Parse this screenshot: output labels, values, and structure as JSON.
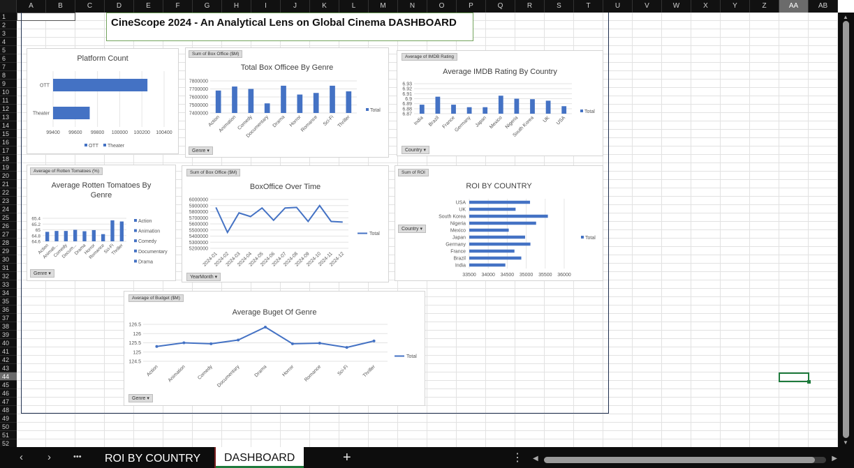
{
  "sheet": {
    "columns": [
      "A",
      "B",
      "C",
      "D",
      "E",
      "F",
      "G",
      "H",
      "I",
      "J",
      "K",
      "L",
      "M",
      "N",
      "O",
      "P",
      "Q",
      "R",
      "S",
      "T",
      "U",
      "V",
      "W",
      "X",
      "Y",
      "Z",
      "AA",
      "AB"
    ],
    "selected_column": "AA",
    "rows": [
      "1",
      "2",
      "3",
      "4",
      "5",
      "6",
      "7",
      "8",
      "9",
      "10",
      "11",
      "12",
      "13",
      "14",
      "15",
      "16",
      "17",
      "18",
      "19",
      "20",
      "21",
      "22",
      "23",
      "24",
      "25",
      "26",
      "27",
      "28",
      "29",
      "30",
      "31",
      "32",
      "33",
      "34",
      "35",
      "36",
      "37",
      "38",
      "39",
      "40",
      "41",
      "42",
      "43",
      "44",
      "45",
      "46",
      "47",
      "48",
      "49",
      "50",
      "51",
      "52"
    ],
    "selected_row": "44"
  },
  "dashboard_title": "CineScope 2024 - An Analytical Lens on Global Cinema  DASHBOARD",
  "colors": {
    "bar": "#4472c4",
    "line": "#4472c4",
    "accent": "#1e7a3c"
  },
  "charts": {
    "platform": {
      "title": "Platform Count",
      "legend": [
        "OTT",
        "Theater"
      ],
      "chart_data": {
        "type": "bar",
        "orientation": "horizontal",
        "categories": [
          "OTT",
          "Theater"
        ],
        "values": [
          100250,
          99730
        ],
        "xlim": [
          99400,
          100400
        ],
        "xticks": [
          "99400",
          "99600",
          "99800",
          "100000",
          "100200",
          "100400"
        ]
      }
    },
    "genre_box": {
      "title": "Total Box Officee By Genre",
      "field": "Sum of Box Office ($M)",
      "filter": "Genre",
      "legend": "Total",
      "chart_data": {
        "type": "bar",
        "categories": [
          "Action",
          "Animation",
          "Comedy",
          "Documentary",
          "Drama",
          "Horror",
          "Romance",
          "Sci-Fi",
          "Thriller"
        ],
        "values": [
          7680000,
          7730000,
          7700000,
          7520000,
          7740000,
          7630000,
          7650000,
          7740000,
          7670000
        ],
        "ylim": [
          7400000,
          7800000
        ],
        "yticks": [
          "7400000",
          "7500000",
          "7600000",
          "7700000",
          "7800000"
        ]
      }
    },
    "imdb": {
      "title": "Average IMDB Rating By Country",
      "field": "Average of IMDB Rating",
      "filter": "Country",
      "legend": "Total",
      "chart_data": {
        "type": "bar",
        "categories": [
          "India",
          "Brazil",
          "France",
          "Germany",
          "Japan",
          "Mexico",
          "Nigeria",
          "South Korea",
          "UK",
          "USA"
        ],
        "values": [
          6.888,
          6.904,
          6.888,
          6.883,
          6.883,
          6.906,
          6.9,
          6.899,
          6.896,
          6.885
        ],
        "ylim": [
          6.87,
          6.93
        ],
        "yticks": [
          "6.87",
          "6.88",
          "6.89",
          "6.9",
          "6.91",
          "6.92",
          "6.93"
        ]
      }
    },
    "rotten": {
      "title": "Average Rotten Tomatoes By Genre",
      "field": "Average of Rotten Tomatoes (%)",
      "filter": "Genre",
      "legend": [
        "Action",
        "Animation",
        "Comedy",
        "Documentary",
        "Drama"
      ],
      "chart_data": {
        "type": "bar",
        "categories": [
          "Action",
          "Animati...",
          "Comedy",
          "Docum...",
          "Drama",
          "Horror",
          "Romance",
          "Sci-Fi",
          "Thriller"
        ],
        "values": [
          64.93,
          64.96,
          64.96,
          65.0,
          64.95,
          64.99,
          64.85,
          65.33,
          65.29
        ],
        "ylim": [
          64.6,
          65.4
        ],
        "yticks": [
          "64.6",
          "64.8",
          "65",
          "65.2",
          "65.4"
        ]
      }
    },
    "timeline": {
      "title": "BoxOffice Over Time",
      "field": "Sum of Box Office ($M)",
      "filter": "YearMonth",
      "legend": "Total",
      "chart_data": {
        "type": "line",
        "x": [
          "2024-01",
          "2024-02",
          "2024-03",
          "2024-04",
          "2024-05",
          "2024-06",
          "2024-07",
          "2024-08",
          "2024-09",
          "2024-10",
          "2024-11",
          "2024-12"
        ],
        "values": [
          5870000,
          5460000,
          5780000,
          5720000,
          5860000,
          5660000,
          5860000,
          5870000,
          5640000,
          5900000,
          5640000,
          5630000
        ],
        "ylim": [
          5200000,
          6000000
        ],
        "yticks": [
          "5200000",
          "5300000",
          "5400000",
          "5500000",
          "5600000",
          "5700000",
          "5800000",
          "5900000",
          "6000000"
        ]
      }
    },
    "roi": {
      "title": "ROI BY  COUNTRY",
      "field": "Sum of ROI",
      "filter": "Country",
      "legend": "Total",
      "chart_data": {
        "type": "bar",
        "orientation": "horizontal",
        "categories": [
          "USA",
          "UK",
          "South Korea",
          "Nigeria",
          "Mexico",
          "Japan",
          "Germany",
          "France",
          "Brazil",
          "India"
        ],
        "values": [
          35100,
          34720,
          35570,
          35260,
          34540,
          34970,
          35110,
          34690,
          34870,
          34450
        ],
        "xlim": [
          33500,
          36000
        ],
        "xticks": [
          "33500",
          "34000",
          "34500",
          "35000",
          "35500",
          "36000"
        ]
      }
    },
    "budget": {
      "title": "Average Buget Of Genre",
      "field": "Average of Budget ($M)",
      "filter": "Genre",
      "legend": "Total",
      "chart_data": {
        "type": "line",
        "x": [
          "Action",
          "Animation",
          "Comedy",
          "Documentary",
          "Drama",
          "Horror",
          "Romance",
          "Sci-Fi",
          "Thriller"
        ],
        "values": [
          125.3,
          125.5,
          125.45,
          125.65,
          126.35,
          125.45,
          125.48,
          125.25,
          125.6
        ],
        "ylim": [
          124.5,
          126.5
        ],
        "yticks": [
          "124.5",
          "125",
          "125.5",
          "126",
          "126.5"
        ]
      }
    }
  },
  "tabs": {
    "roi": "ROI BY COUNTRY",
    "dashboard": "DASHBOARD",
    "add": "+",
    "prev": "‹",
    "next": "›",
    "more": "•••",
    "menu": "⋮"
  }
}
